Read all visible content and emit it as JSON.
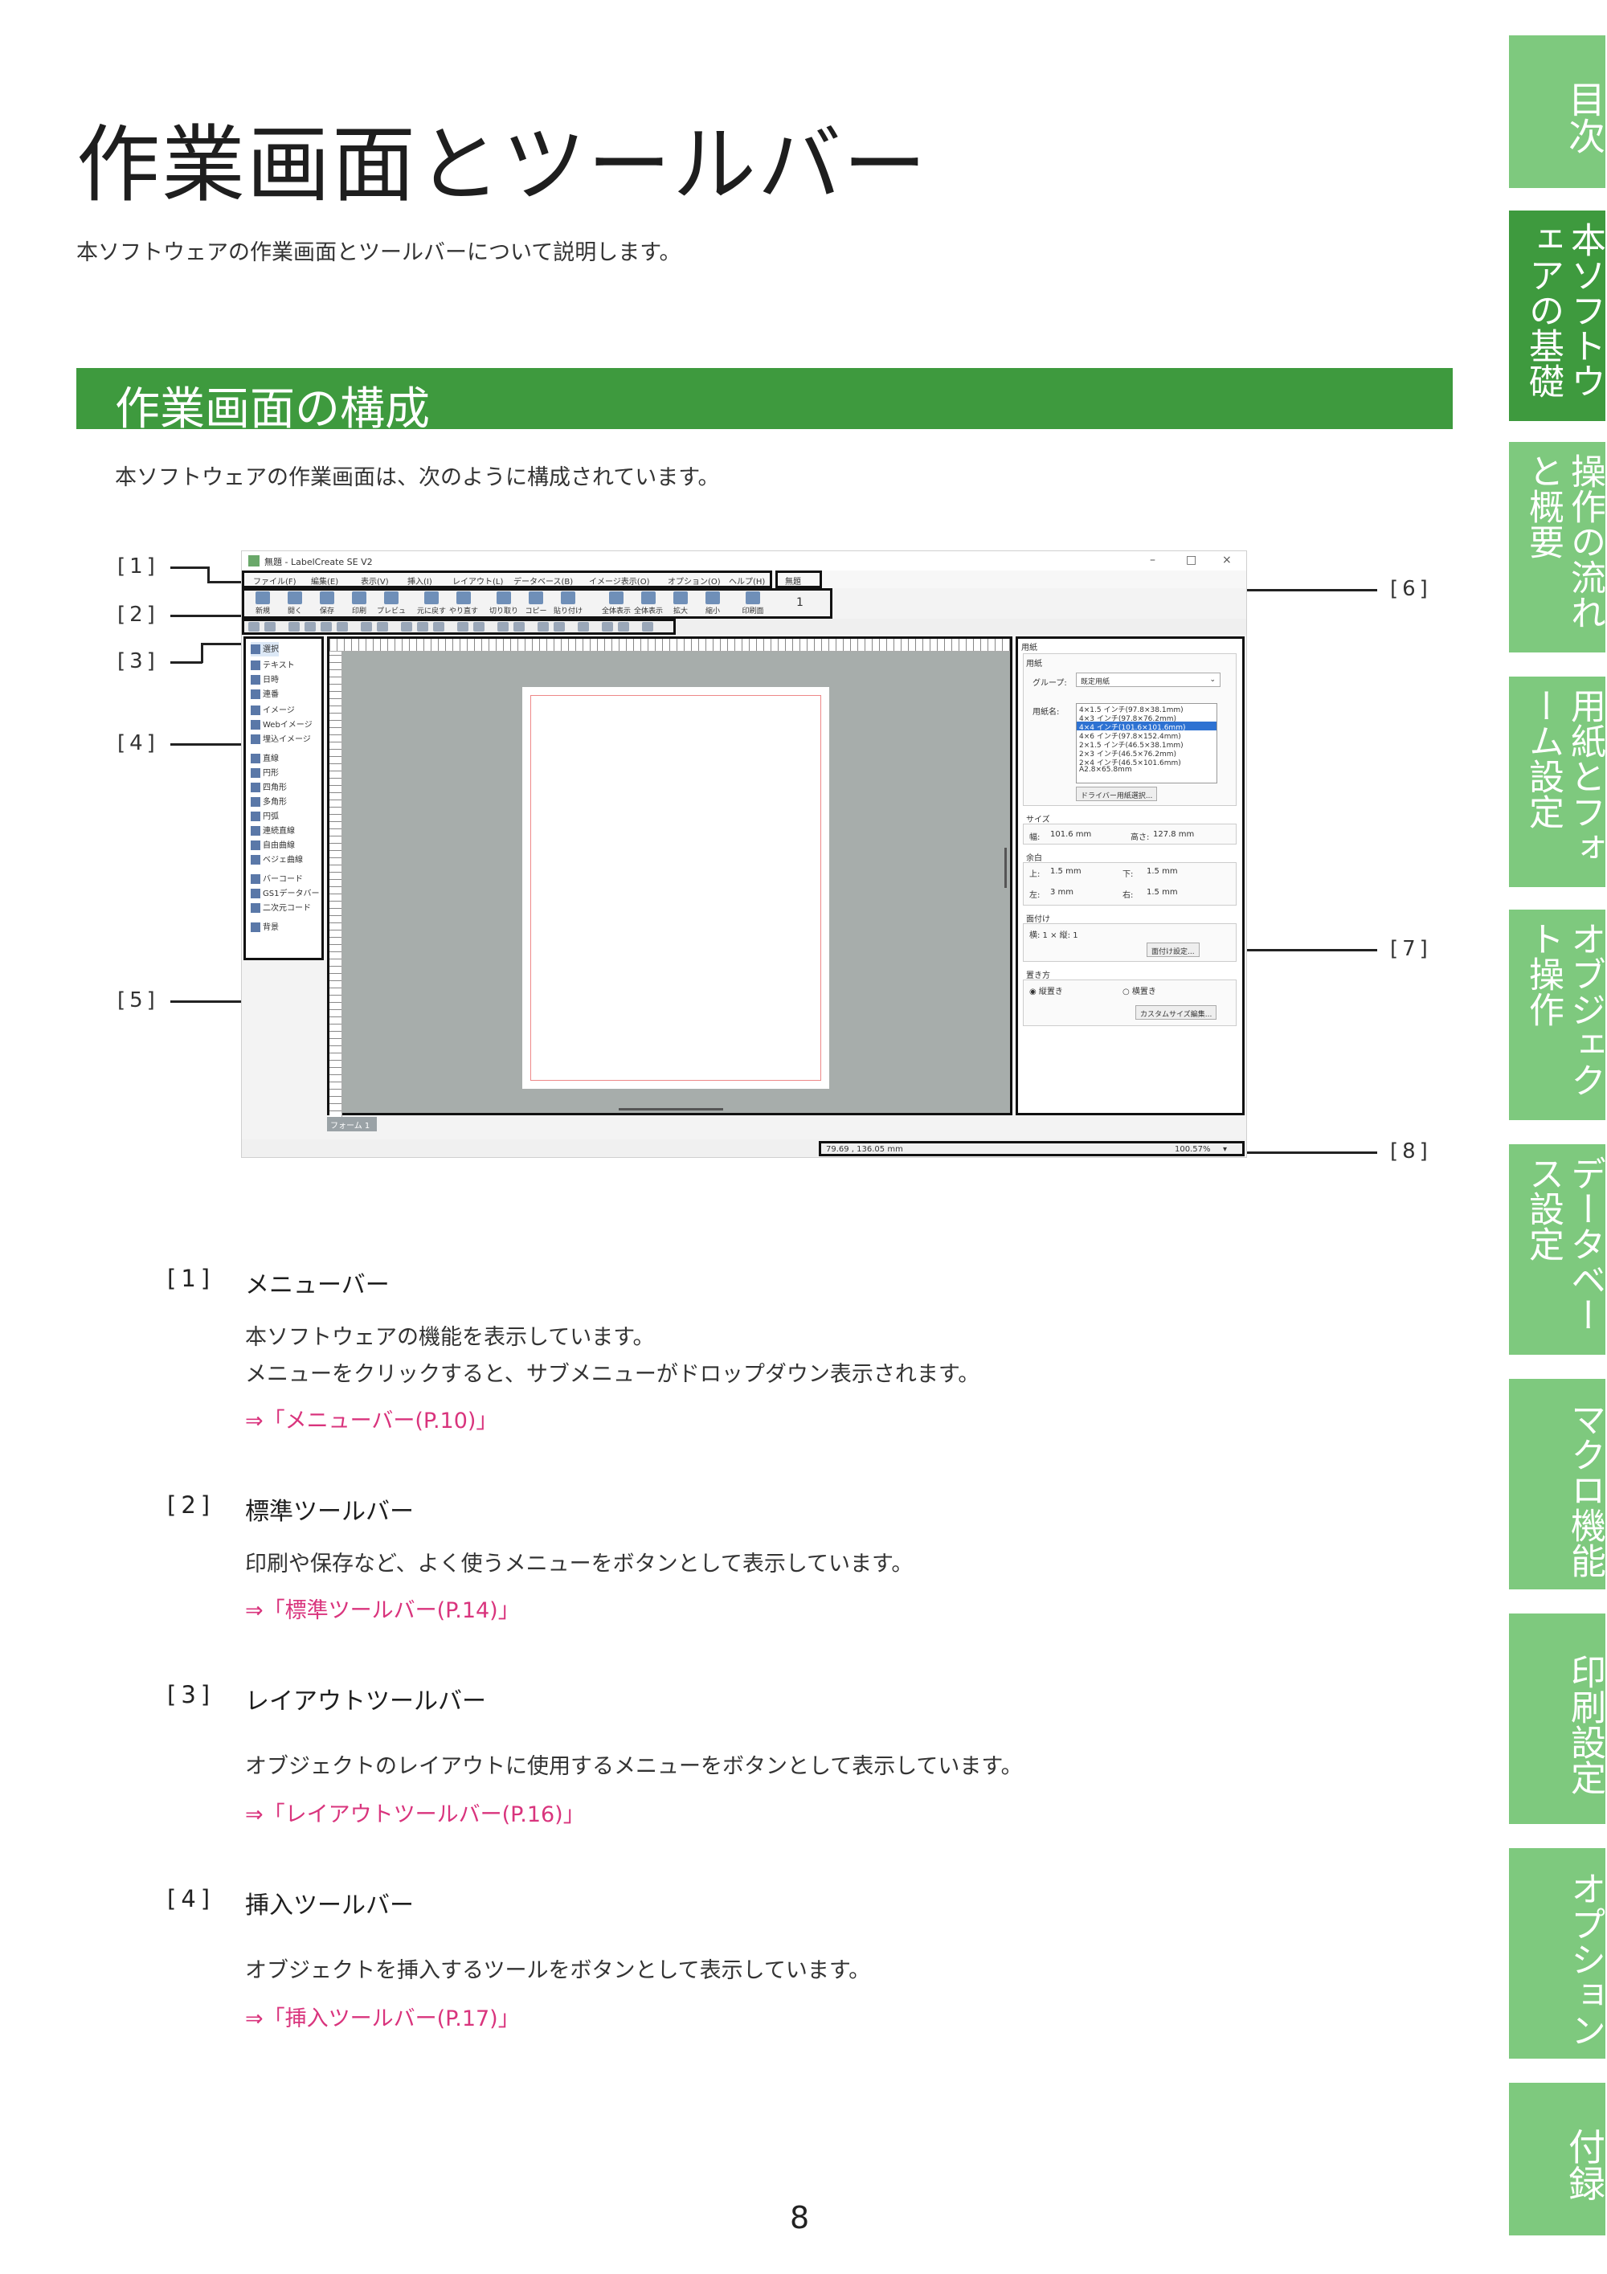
{
  "header": {
    "title": "作業画面とツールバー",
    "subtitle": "本ソフトウェアの作業画面とツールバーについて説明します。"
  },
  "section": {
    "title": "作業画面の構成",
    "intro": "本ソフトウェアの作業画面は、次のように構成されています。"
  },
  "callouts": {
    "c1": "[1]",
    "c2": "[2]",
    "c3": "[3]",
    "c4": "[4]",
    "c5": "[5]",
    "c6": "[6]",
    "c7": "[7]",
    "c8": "[8]"
  },
  "screenshot": {
    "window_title": "無題 - LabelCreate SE V2",
    "menus": [
      "ファイル(F)",
      "編集(E)",
      "表示(V)",
      "挿入(I)",
      "レイアウト(L)",
      "データベース(B)",
      "イメージ表示(O)",
      "オプション(O)",
      "ヘルプ(H)"
    ],
    "menu_extra": "無題",
    "toolbar_buttons": [
      "新規",
      "開く",
      "保存",
      "印刷",
      "プレビュー",
      "元に戻す",
      "やり直す",
      "切り取り",
      "コピー",
      "貼り付け",
      "全体表示",
      "全体表示",
      "拡大",
      "縮小",
      "印刷面"
    ],
    "toolbar_counter": "1",
    "insert_tools": [
      "選択",
      "テキスト",
      "日時",
      "連番",
      "イメージ",
      "Webイメージ",
      "埋込イメージ",
      "直線",
      "円形",
      "四角形",
      "多角形",
      "円弧",
      "連続直線",
      "自由曲線",
      "ベジェ曲線",
      "バーコード",
      "GS1データバー",
      "二次元コード",
      "背景"
    ],
    "form_tab": "フォーム 1",
    "props": {
      "header": "用紙",
      "group_label": "用紙",
      "group_select_label": "グループ:",
      "group_select_value": "既定用紙",
      "paper_name_label": "用紙名:",
      "paper_list": [
        "4×1.5 インチ(97.8×38.1mm)",
        "4×3 インチ(97.8×76.2mm)",
        "4×4 インチ(101.6×101.6mm)",
        "4×6 インチ(97.8×152.4mm)",
        "2×1.5 インチ(46.5×38.1mm)",
        "2×3 インチ(46.5×76.2mm)",
        "2×4 インチ(46.5×101.6mm)",
        "A2.8×65.8mm"
      ],
      "paper_selected_index": 2,
      "driver_button": "ドライバー用紙選択...",
      "size_label": "サイズ",
      "width_label": "幅:",
      "width_value": "101.6 mm",
      "height_label": "高さ:",
      "height_value": "127.8 mm",
      "margin_label": "余白",
      "top_label": "上:",
      "top_value": "1.5 mm",
      "bottom_label": "下:",
      "bottom_value": "1.5 mm",
      "left_label": "左:",
      "left_value": "3 mm",
      "right_label": "右:",
      "right_value": "1.5 mm",
      "imposition_label": "面付け",
      "imposition_value": "横: 1 × 縦: 1",
      "imposition_button": "面付け設定...",
      "orientation_label": "置き方",
      "portrait": "縦置き",
      "landscape": "横置き",
      "custom_button": "カスタムサイズ編集..."
    },
    "status_coords": "79.69 , 136.05 mm",
    "status_zoom": "100.57%"
  },
  "items": [
    {
      "num": "[1]",
      "title": "メニューバー",
      "body1": "本ソフトウェアの機能を表示しています。",
      "body2": "メニューをクリックすると、サブメニューがドロップダウン表示されます。",
      "link": "⇒「メニューバー(P.10)」"
    },
    {
      "num": "[2]",
      "title": "標準ツールバー",
      "body1": "印刷や保存など、よく使うメニューをボタンとして表示しています。",
      "link": "⇒「標準ツールバー(P.14)」"
    },
    {
      "num": "[3]",
      "title": "レイアウトツールバー",
      "body1": "オブジェクトのレイアウトに使用するメニューをボタンとして表示しています。",
      "link": "⇒「レイアウトツールバー(P.16)」"
    },
    {
      "num": "[4]",
      "title": "挿入ツールバー",
      "body1": "オブジェクトを挿入するツールをボタンとして表示しています。",
      "link": "⇒「挿入ツールバー(P.17)」"
    }
  ],
  "page_number": "8",
  "side_tabs": [
    {
      "label": "目次",
      "active": false
    },
    {
      "label": "本ソフトウェアの基礎",
      "active": true
    },
    {
      "label": "操作の流れと概要",
      "active": false
    },
    {
      "label": "用紙とフォーム設定",
      "active": false
    },
    {
      "label": "オブジェクト操作",
      "active": false
    },
    {
      "label": "データベース設定",
      "active": false
    },
    {
      "label": "マクロ機能",
      "active": false
    },
    {
      "label": "印刷設定",
      "active": false
    },
    {
      "label": "オプション",
      "active": false
    },
    {
      "label": "付録",
      "active": false
    }
  ],
  "colors": {
    "section_green": "#3e9a3e",
    "tab_green": "#7ec97e",
    "link_pink": "#d9347d"
  }
}
